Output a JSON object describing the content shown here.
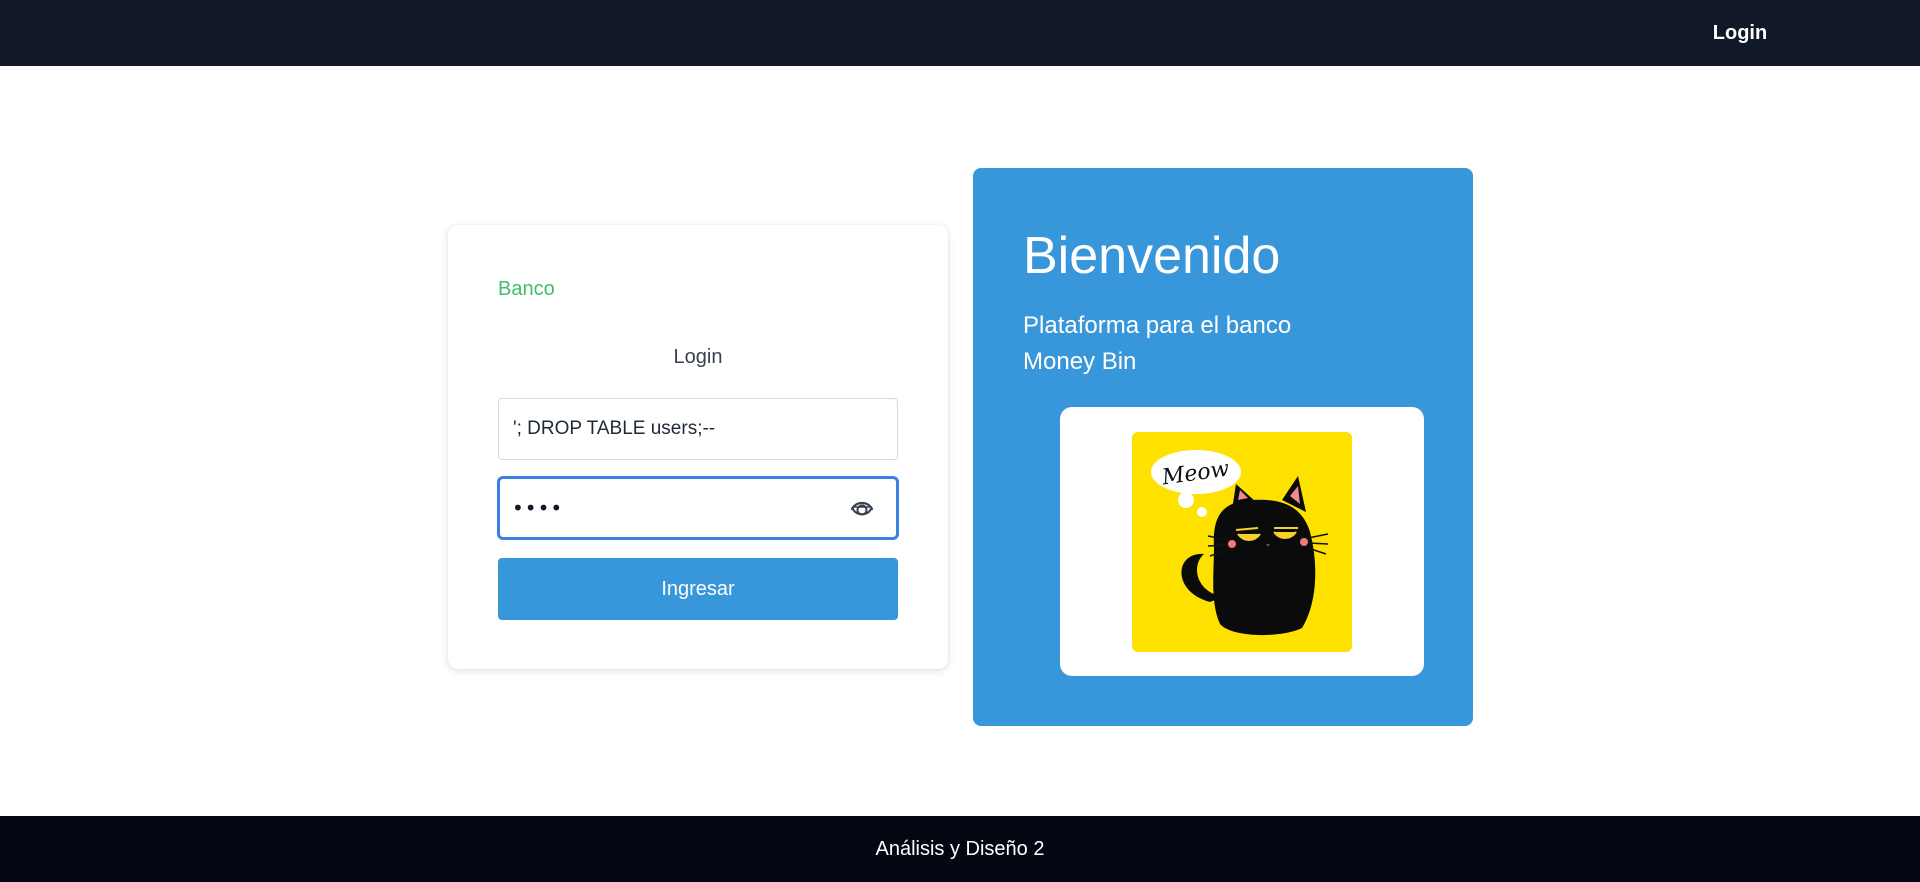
{
  "nav": {
    "login_label": "Login"
  },
  "login_card": {
    "brand": "Banco",
    "title": "Login",
    "username_value": "'; DROP TABLE users;--",
    "password_value": "••••",
    "submit_label": "Ingresar"
  },
  "welcome": {
    "title": "Bienvenido",
    "subtitle": "Plataforma para el banco Money Bin",
    "image_text": "Meow"
  },
  "footer": {
    "text": "Análisis y Diseño 2"
  },
  "colors": {
    "topbar": "#111827",
    "footer": "#030712",
    "brand": "#3fbf6a",
    "accent": "#3897db",
    "focus": "#3b7fe0",
    "cat_bg": "#ffe100"
  },
  "icons": {
    "password_toggle": "eye-icon"
  }
}
